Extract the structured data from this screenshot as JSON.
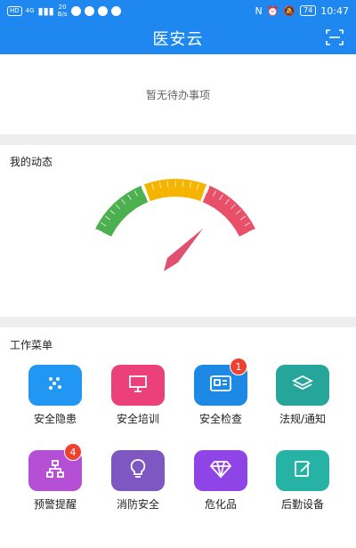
{
  "status_bar": {
    "network_badge": "HD",
    "signal_text": "4G",
    "speed_value": "20",
    "speed_unit": "B/s",
    "battery": "74",
    "time": "10:47"
  },
  "header": {
    "title": "医安云"
  },
  "todo": {
    "empty_text": "暂无待办事项"
  },
  "dynamic": {
    "title": "我的动态",
    "gauge_colors": [
      "#4caf50",
      "#f5b400",
      "#e8506a"
    ]
  },
  "menu": {
    "title": "工作菜单",
    "items": [
      {
        "label": "安全隐患",
        "icon": "dots-grid-icon",
        "color": "#2196f3"
      },
      {
        "label": "安全培训",
        "icon": "presentation-board-icon",
        "color": "#ec407a"
      },
      {
        "label": "安全检查",
        "icon": "id-card-icon",
        "color": "#1e88e5",
        "badge": "1"
      },
      {
        "label": "法规/通知",
        "icon": "layers-icon",
        "color": "#26a69a"
      },
      {
        "label": "预警提醒",
        "icon": "org-chart-icon",
        "color": "#b44fd6",
        "badge": "4"
      },
      {
        "label": "消防安全",
        "icon": "lightbulb-icon",
        "color": "#7e57c2"
      },
      {
        "label": "危化品",
        "icon": "diamond-icon",
        "color": "#8e44e6"
      },
      {
        "label": "后勤设备",
        "icon": "edit-doc-icon",
        "color": "#26b3a5"
      }
    ]
  }
}
